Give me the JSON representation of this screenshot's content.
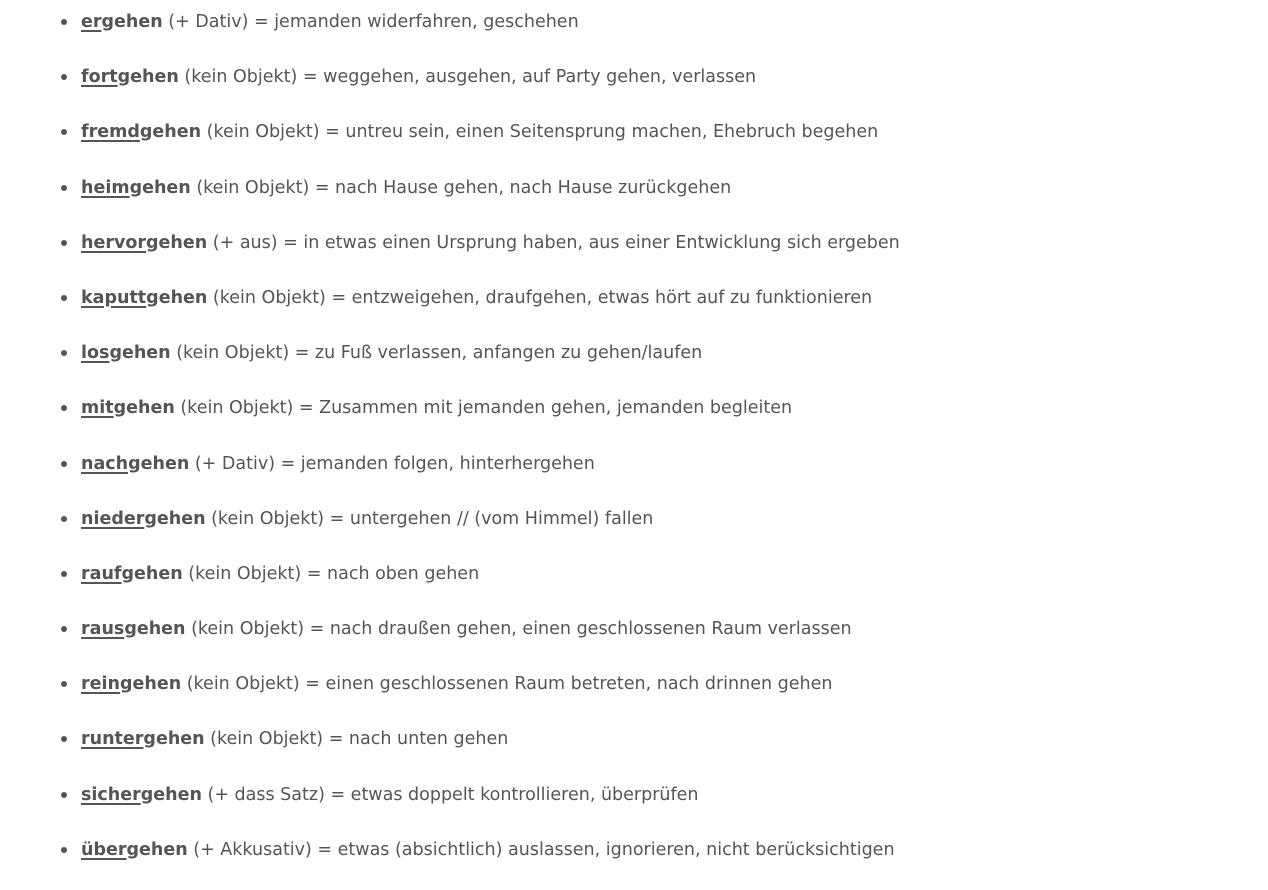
{
  "verbs": [
    {
      "prefix": "er",
      "stem": "gehen",
      "rest": " (+ Dativ) = jemanden widerfahren, geschehen"
    },
    {
      "prefix": "fort",
      "stem": "gehen",
      "rest": " (kein Objekt) = weggehen, ausgehen, auf Party gehen, verlassen"
    },
    {
      "prefix": "fremd",
      "stem": "gehen",
      "rest": " (kein Objekt) = untreu sein, einen Seitensprung machen, Ehebruch begehen"
    },
    {
      "prefix": "heim",
      "stem": "gehen",
      "rest": " (kein Objekt) = nach Hause gehen, nach Hause zurückgehen"
    },
    {
      "prefix": "hervor",
      "stem": "gehen",
      "rest": " (+ aus) = in etwas einen Ursprung haben, aus einer Entwicklung sich ergeben"
    },
    {
      "prefix": "kaputt",
      "stem": "gehen",
      "rest": " (kein Objekt) = entzweigehen, draufgehen, etwas hört auf zu funktionieren"
    },
    {
      "prefix": "los",
      "stem": "gehen",
      "rest": " (kein Objekt) = zu Fuß verlassen, anfangen zu gehen/laufen"
    },
    {
      "prefix": "mit",
      "stem": "gehen",
      "rest": " (kein Objekt) = Zusammen mit jemanden gehen, jemanden begleiten"
    },
    {
      "prefix": "nach",
      "stem": "gehen",
      "rest": " (+ Dativ) = jemanden folgen, hinterhergehen"
    },
    {
      "prefix": "nieder",
      "stem": "gehen",
      "rest": " (kein Objekt) = untergehen // (vom Himmel) fallen"
    },
    {
      "prefix": "rauf",
      "stem": "gehen",
      "rest": " (kein Objekt) = nach oben gehen"
    },
    {
      "prefix": "raus",
      "stem": "gehen",
      "rest": " (kein Objekt) = nach draußen gehen, einen geschlossenen Raum verlassen"
    },
    {
      "prefix": "rein",
      "stem": "gehen",
      "rest": " (kein Objekt) = einen geschlossenen Raum betreten, nach drinnen gehen"
    },
    {
      "prefix": "runter",
      "stem": "gehen",
      "rest": " (kein Objekt) = nach unten gehen"
    },
    {
      "prefix": "sicher",
      "stem": "gehen",
      "rest": " (+ dass Satz) = etwas doppelt kontrollieren, überprüfen"
    },
    {
      "prefix": "über",
      "stem": "gehen",
      "rest": " (+ Akkusativ) = etwas (absichtlich) auslassen, ignorieren, nicht berücksichtigen"
    }
  ]
}
